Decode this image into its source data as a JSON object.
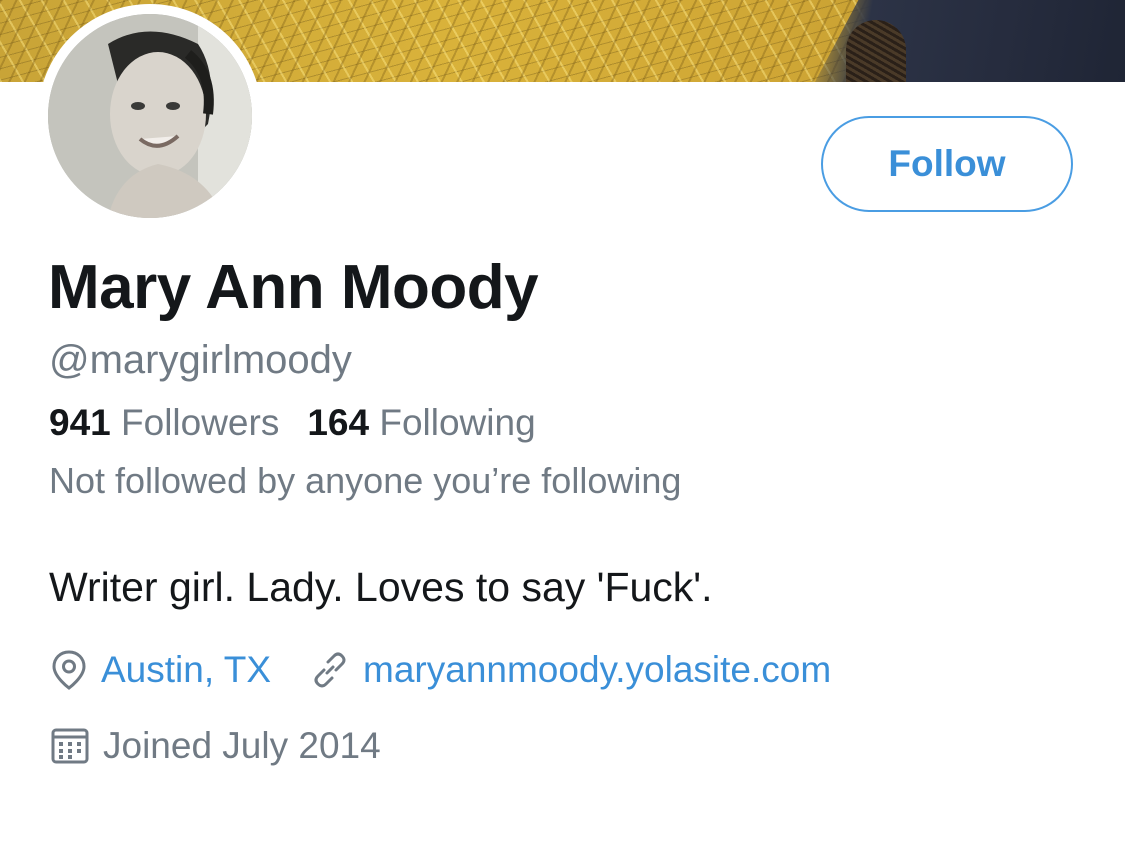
{
  "profile": {
    "name": "Mary Ann Moody",
    "handle": "@marygirlmoody",
    "follow_label": "Follow",
    "followers_count": "941",
    "followers_label": "Followers",
    "following_count": "164",
    "following_label": "Following",
    "not_followed_text": "Not followed by anyone you’re following",
    "bio": "Writer girl. Lady. Loves to say 'Fuck'.",
    "location": "Austin, TX",
    "website": "maryannmoody.yolasite.com",
    "joined": "Joined July 2014"
  },
  "icons": {
    "location": "location-pin-icon",
    "link": "link-icon",
    "calendar": "calendar-icon"
  },
  "colors": {
    "accent": "#3a8fd8",
    "text_primary": "#14171a",
    "text_secondary": "#707a84",
    "banner": "#d4ac38"
  }
}
